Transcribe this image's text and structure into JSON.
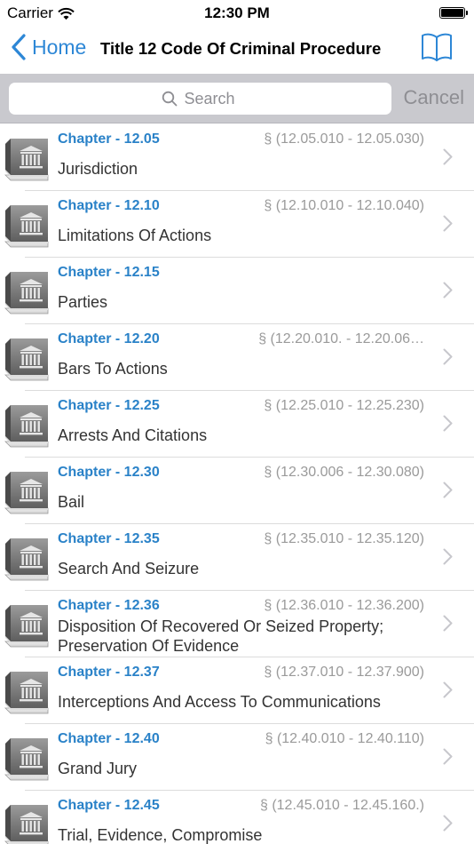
{
  "status_bar": {
    "carrier": "Carrier",
    "time": "12:30 PM"
  },
  "nav": {
    "back_label": "Home",
    "title": "Title 12 Code Of Criminal Procedure"
  },
  "search": {
    "placeholder": "Search",
    "cancel_label": "Cancel"
  },
  "colors": {
    "accent": "#2d87d6",
    "chapter_blue": "#2a82c8",
    "range_gray": "#9a9a9a",
    "search_bar_bg": "#c9c9ce"
  },
  "chapters": [
    {
      "chapter": "Chapter - 12.05",
      "range": "§ (12.05.010 - 12.05.030)",
      "name": "Jurisdiction"
    },
    {
      "chapter": "Chapter - 12.10",
      "range": "§ (12.10.010 - 12.10.040)",
      "name": "Limitations Of Actions"
    },
    {
      "chapter": "Chapter - 12.15",
      "range": "",
      "name": "Parties"
    },
    {
      "chapter": "Chapter - 12.20",
      "range": "§ (12.20.010. - 12.20.06…",
      "name": "Bars To Actions"
    },
    {
      "chapter": "Chapter - 12.25",
      "range": "§ (12.25.010 - 12.25.230)",
      "name": "Arrests And Citations"
    },
    {
      "chapter": "Chapter - 12.30",
      "range": "§ (12.30.006 - 12.30.080)",
      "name": "Bail"
    },
    {
      "chapter": "Chapter - 12.35",
      "range": "§ (12.35.010 - 12.35.120)",
      "name": "Search And Seizure"
    },
    {
      "chapter": "Chapter - 12.36",
      "range": "§ (12.36.010 - 12.36.200)",
      "name": "Disposition Of Recovered Or Seized Property; Preservation Of Evidence"
    },
    {
      "chapter": "Chapter - 12.37",
      "range": "§ (12.37.010 - 12.37.900)",
      "name": "Interceptions And Access To Communications"
    },
    {
      "chapter": "Chapter - 12.40",
      "range": "§ (12.40.010 - 12.40.110)",
      "name": "Grand Jury"
    },
    {
      "chapter": "Chapter - 12.45",
      "range": "§ (12.45.010 - 12.45.160.)",
      "name": "Trial, Evidence, Compromise"
    }
  ]
}
